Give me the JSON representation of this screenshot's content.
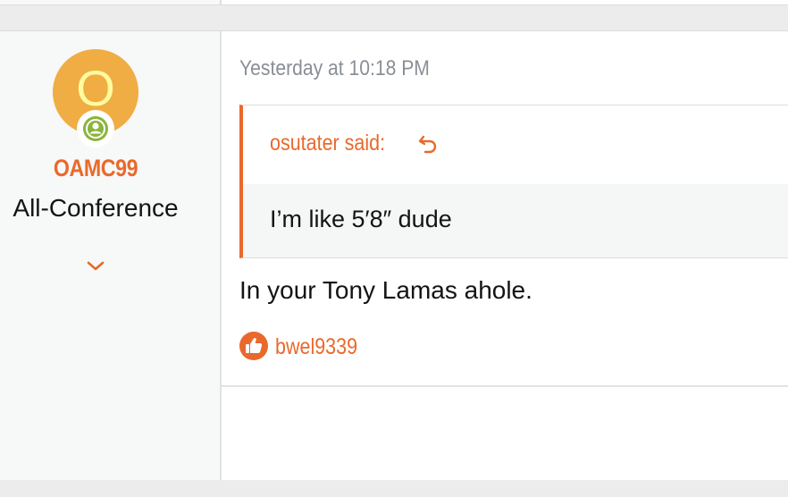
{
  "author": {
    "avatar_letter": "O",
    "username": "OAMC99",
    "user_title": "All-Conference",
    "online_status": "online-person-icon"
  },
  "post": {
    "timestamp": "Yesterday at 10:18 PM",
    "quote": {
      "author_said": "osutater said:",
      "text": "I’m like 5′8″ dude",
      "jump_icon": "undo-arrow-icon"
    },
    "message": "In your Tony Lamas ahole.",
    "reactions": {
      "icon": "thumbs-up-icon",
      "users": "bwel9339"
    }
  },
  "colors": {
    "accent": "#e9692c",
    "avatar_bg": "#f0ad43",
    "avatar_letter": "#fffb9e",
    "online": "#8bb43c",
    "page_bg": "#ececec",
    "sidebar_bg": "#f7f8f8"
  }
}
